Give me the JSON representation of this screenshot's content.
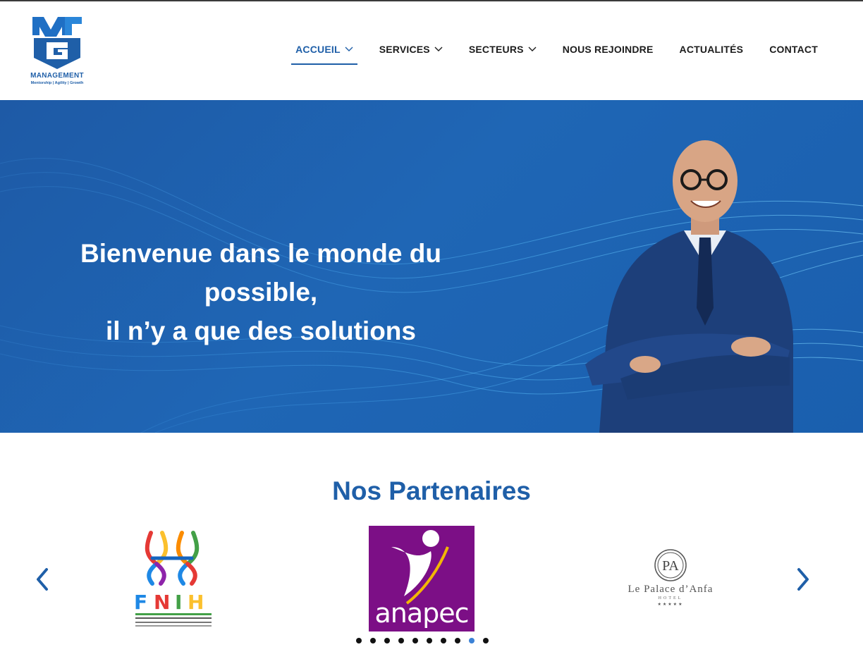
{
  "logo": {
    "initials": "MAG",
    "name": "MANAGEMENT",
    "tagline": "Mentorship | Agility | Growth"
  },
  "nav": {
    "items": [
      {
        "label": "ACCUEIL",
        "active": true,
        "has_dropdown": true
      },
      {
        "label": "SERVICES",
        "active": false,
        "has_dropdown": true
      },
      {
        "label": "SECTEURS",
        "active": false,
        "has_dropdown": true
      },
      {
        "label": "NOUS REJOINDRE",
        "active": false,
        "has_dropdown": false
      },
      {
        "label": "ACTUALITÉS",
        "active": false,
        "has_dropdown": false
      },
      {
        "label": "CONTACT",
        "active": false,
        "has_dropdown": false
      }
    ]
  },
  "hero": {
    "line1": "Bienvenue dans le monde du",
    "line2": "possible,",
    "line3": "il n’y a que des solutions"
  },
  "partners": {
    "title": "Nos Partenaires",
    "logos": [
      {
        "name": "FNIH"
      },
      {
        "name": "anapec"
      },
      {
        "name": "Le Palace d'Anfa",
        "text": "Le Palace d’Anfa",
        "sub": "HOTEL",
        "stars": "★★★★★"
      }
    ],
    "prev_icon": "chevron-left-icon",
    "next_icon": "chevron-right-icon",
    "dot_count": 10,
    "active_dot": 8
  },
  "colors": {
    "brand_blue": "#1f5fa8",
    "hero_bg": "#1e5aa6",
    "anapec_purple": "#7c0f86",
    "dot_active": "#3b82d6"
  }
}
